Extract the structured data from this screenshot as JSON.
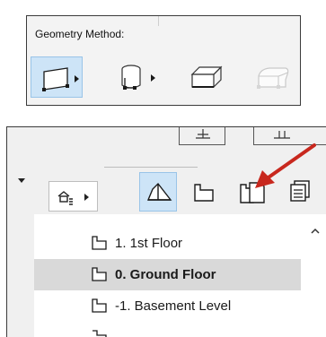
{
  "geometry": {
    "label": "Geometry Method:",
    "buttons": [
      {
        "id": "box",
        "icon": "rectangle-box-icon",
        "selected": true,
        "has_flyout": true
      },
      {
        "id": "cylinder",
        "icon": "cylinder-icon",
        "selected": false,
        "has_flyout": true
      },
      {
        "id": "box-3d",
        "icon": "slanted-box-icon",
        "selected": false,
        "has_flyout": false
      },
      {
        "id": "rounded",
        "icon": "rounded-block-icon",
        "selected": false,
        "has_flyout": false,
        "disabled": true
      }
    ]
  },
  "toolbar": {
    "view_button_icon": "story-view-icon",
    "tools": [
      {
        "id": "roof",
        "icon": "roof-house-icon",
        "selected": true
      },
      {
        "id": "story",
        "icon": "story-outline-icon",
        "selected": false
      },
      {
        "id": "story-settings",
        "icon": "story-settings-icon",
        "selected": false,
        "highlighted_by_arrow": true
      },
      {
        "id": "stacked",
        "icon": "stacked-pages-icon",
        "selected": false
      }
    ],
    "accent_color": "#cde4f7",
    "arrow_color": "#c8281e"
  },
  "stories": [
    {
      "label": "1. 1st Floor",
      "selected": false
    },
    {
      "label": "0. Ground Floor",
      "selected": true
    },
    {
      "label": "-1. Basement Level",
      "selected": false
    }
  ]
}
